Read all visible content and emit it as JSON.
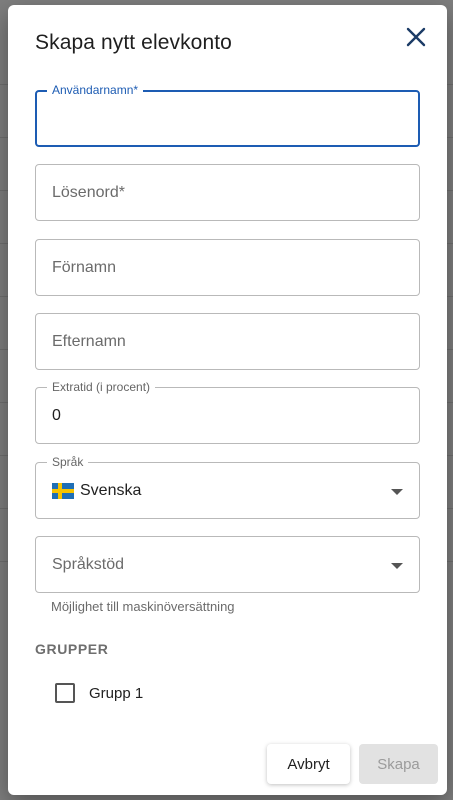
{
  "dialog": {
    "title": "Skapa nytt elevkonto",
    "close_icon": "close-icon"
  },
  "fields": {
    "username": {
      "label": "Användarnamn*",
      "value": ""
    },
    "password": {
      "placeholder": "Lösenord*"
    },
    "first_name": {
      "placeholder": "Förnamn"
    },
    "last_name": {
      "placeholder": "Efternamn"
    },
    "extra_time": {
      "label": "Extratid (i procent)",
      "value": "0"
    },
    "language": {
      "label": "Språk",
      "value": "Svenska",
      "flag_icon": "sweden-flag-icon"
    },
    "language_support": {
      "placeholder": "Språkstöd",
      "helper": "Möjlighet till maskinöversättning"
    }
  },
  "groups": {
    "title": "GRUPPER",
    "items": [
      {
        "label": "Grupp 1",
        "checked": false
      }
    ]
  },
  "actions": {
    "cancel_label": "Avbryt",
    "create_label": "Skapa"
  },
  "colors": {
    "focus": "#1d5cb3",
    "disabled_bg": "#e2e2e2"
  }
}
